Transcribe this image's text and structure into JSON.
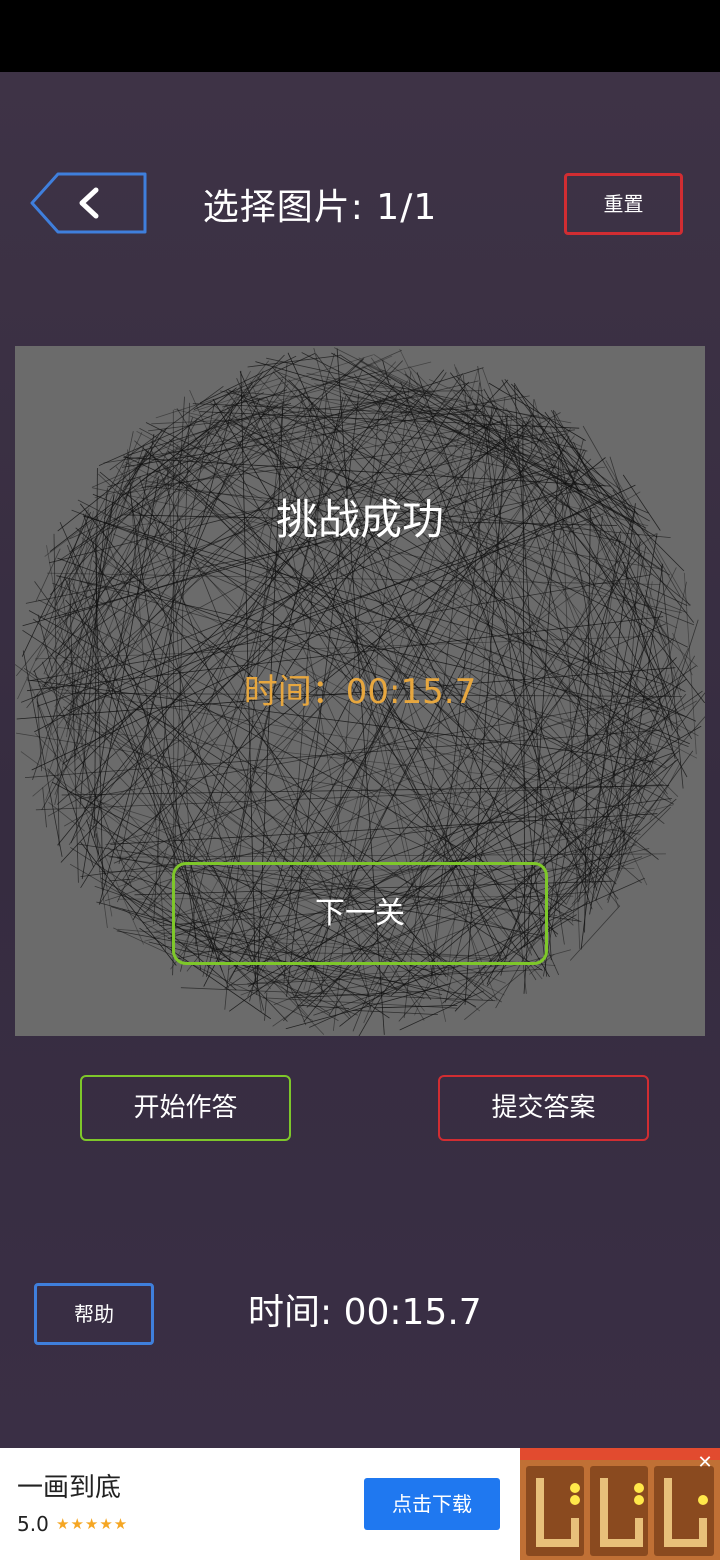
{
  "header": {
    "title": "选择图片: 1/1",
    "reset_label": "重置"
  },
  "result": {
    "title": "挑战成功",
    "time_text": "时间：00:15.7",
    "next_label": "下一关"
  },
  "actions": {
    "start_label": "开始作答",
    "submit_label": "提交答案"
  },
  "footer": {
    "help_label": "帮助",
    "time_text": "时间: 00:15.7"
  },
  "ad": {
    "app_name": "一画到底",
    "rating": "5.0",
    "stars": "★★★★★",
    "download_label": "点击下载",
    "close_icon": "close-icon"
  },
  "colors": {
    "background": "#3a2f45",
    "canvas": "#6b6b6b",
    "accent_green": "#7ec72a",
    "accent_red": "#d12d32",
    "accent_blue": "#3f7fdc",
    "time_orange": "#e7a73f"
  }
}
